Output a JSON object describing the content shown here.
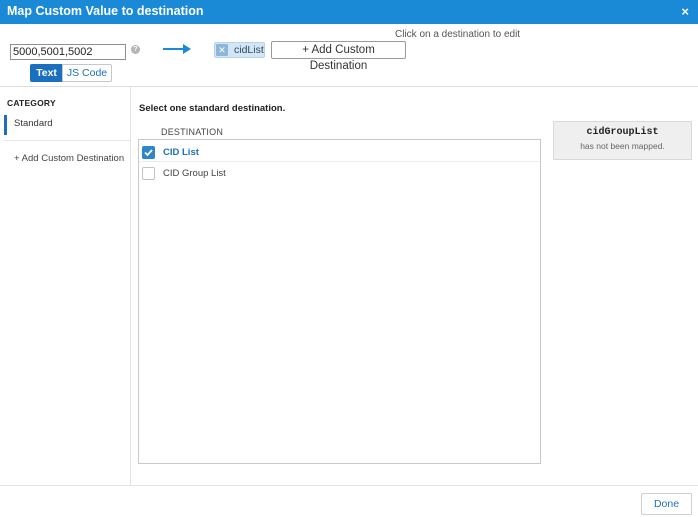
{
  "window": {
    "title": "Map Custom Value to destination",
    "close_glyph": "×",
    "close_icon": "close-icon"
  },
  "header": {
    "hint": "Click on a destination to edit",
    "value_input": "5000,5001,5002",
    "help_glyph": "?",
    "arrow_icon": "arrow-right-icon",
    "arrow_color": "#1a8ad6",
    "mapped_chip": {
      "remove_glyph": "✕",
      "label": "cidList"
    },
    "add_custom_destination": "+ Add Custom Destination",
    "mode_tabs": [
      {
        "label": "Text",
        "active": true
      },
      {
        "label": "JS Code",
        "active": false
      }
    ]
  },
  "sidebar": {
    "title": "CATEGORY",
    "items": [
      {
        "label": "Standard",
        "active": true
      }
    ],
    "add_custom": "+ Add Custom Destination"
  },
  "main": {
    "instruction": "Select one standard destination.",
    "column_header": "DESTINATION",
    "destinations": [
      {
        "label": "CID List",
        "checked": true
      },
      {
        "label": "CID Group List",
        "checked": false
      }
    ]
  },
  "info_panel": {
    "name": "cidGroupList",
    "status": "has not been mapped."
  },
  "footer": {
    "done_label": "Done"
  },
  "colors": {
    "accent": "#1a8ad6",
    "selected": "#1a6fbf",
    "checkbox": "#2e86cc"
  }
}
